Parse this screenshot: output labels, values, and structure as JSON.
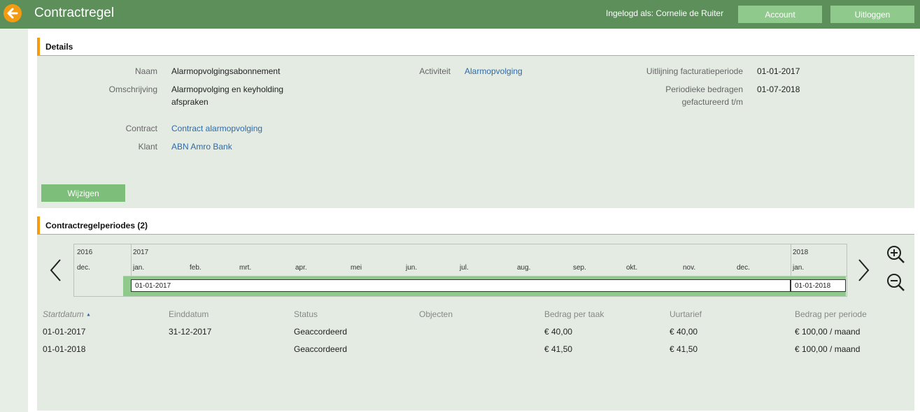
{
  "header": {
    "title": "Contractregel",
    "login_info": "Ingelogd als: Cornelie de Ruiter",
    "account_label": "Account",
    "logout_label": "Uitloggen"
  },
  "details": {
    "section_title": "Details",
    "naam_label": "Naam",
    "naam_value": "Alarmopvolgingsabonnement",
    "omschrijving_label": "Omschrijving",
    "omschrijving_value_line1": "Alarmopvolging en keyholding",
    "omschrijving_value_line2": "afspraken",
    "contract_label": "Contract",
    "contract_value": "Contract alarmopvolging",
    "klant_label": "Klant",
    "klant_value": "ABN Amro Bank",
    "activiteit_label": "Activiteit",
    "activiteit_value": "Alarmopvolging",
    "uitlijning_label": "Uitlijning facturatieperiode",
    "uitlijning_value": "01-01-2017",
    "periodiek_label_line1": "Periodieke bedragen",
    "periodiek_label_line2": "gefactureerd t/m",
    "periodiek_value": "01-07-2018",
    "edit_label": "Wijzigen"
  },
  "periods": {
    "section_title": "Contractregelperiodes (2)",
    "timeline": {
      "years": [
        "2016",
        "2017",
        "2018"
      ],
      "months": [
        "dec.",
        "jan.",
        "feb.",
        "mrt.",
        "apr.",
        "mei",
        "jun.",
        "jul.",
        "aug.",
        "sep.",
        "okt.",
        "nov.",
        "dec.",
        "jan."
      ],
      "period1_label": "01-01-2017",
      "period2_label": "01-01-2018"
    },
    "columns": [
      "Startdatum",
      "Einddatum",
      "Status",
      "Objecten",
      "Bedrag per taak",
      "Uurtarief",
      "Bedrag per periode"
    ],
    "sort_indicator": "▲",
    "rows": [
      [
        "01-01-2017",
        "31-12-2017",
        "Geaccordeerd",
        "",
        "€ 40,00",
        "€ 40,00",
        "€ 100,00 / maand"
      ],
      [
        "01-01-2018",
        "",
        "Geaccordeerd",
        "",
        "€ 41,50",
        "€ 41,50",
        "€ 100,00 / maand"
      ]
    ]
  },
  "icons": {
    "back": "arrow-left-icon",
    "prev": "chevron-left-icon",
    "next": "chevron-right-icon",
    "zoom_in": "zoom-in-icon",
    "zoom_out": "zoom-out-icon"
  },
  "colors": {
    "header_green": "#5c8f5a",
    "button_green": "#8fc98c",
    "accent_orange": "#f39c12",
    "link_blue": "#2f6aa8",
    "panel_bg": "#e3ebe3"
  }
}
